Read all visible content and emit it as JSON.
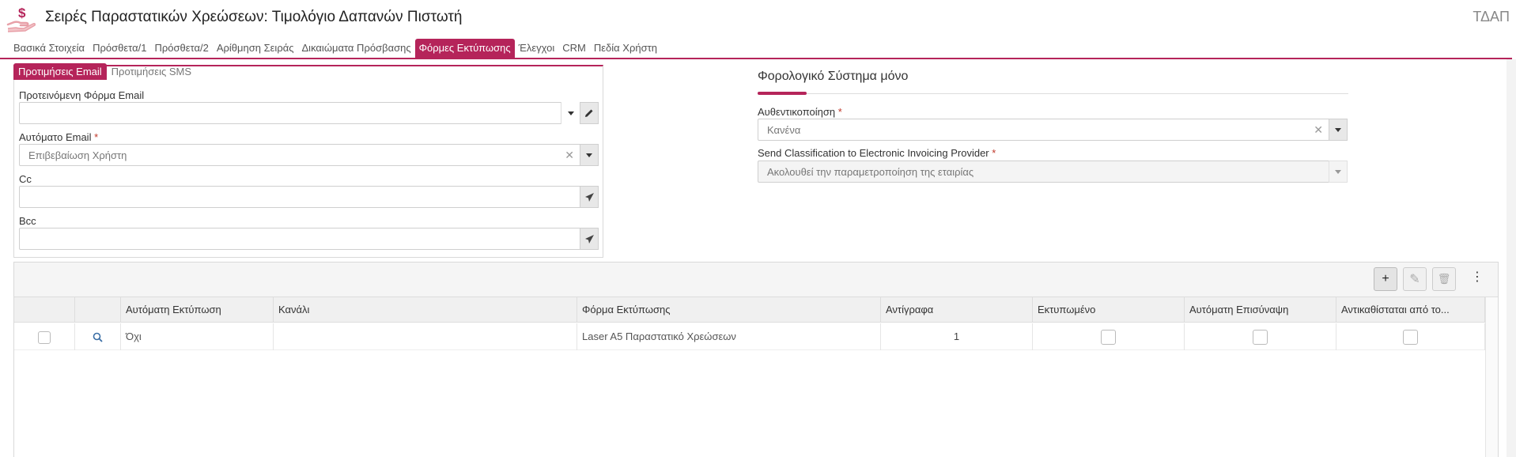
{
  "header": {
    "title": "Σειρές Παραστατικών Χρεώσεων: Τιμολόγιο Δαπανών Πιστωτή",
    "code": "ΤΔΑΠ",
    "icon": "money-hand-icon"
  },
  "tabs": [
    {
      "label": "Βασικά Στοιχεία"
    },
    {
      "label": "Πρόσθετα/1"
    },
    {
      "label": "Πρόσθετα/2"
    },
    {
      "label": "Αρίθμηση Σειράς"
    },
    {
      "label": "Δικαιώματα Πρόσβασης"
    },
    {
      "label": "Φόρμες Εκτύπωσης"
    },
    {
      "label": "Έλεγχοι"
    },
    {
      "label": "CRM"
    },
    {
      "label": "Πεδία Χρήστη"
    }
  ],
  "active_tab": "Φόρμες Εκτύπωσης",
  "email_panel": {
    "subtabs": [
      "Προτιμήσεις Email",
      "Προτιμήσεις SMS"
    ],
    "default_form_label": "Προτεινόμενη Φόρμα Email",
    "default_form_value": "",
    "auto_email_label": "Αυτόματο Email",
    "auto_email_value": "Επιβεβαίωση Χρήστη",
    "cc_label": "Cc",
    "cc_value": "",
    "bcc_label": "Bcc",
    "bcc_value": ""
  },
  "tax_section": {
    "title": "Φορολογικό Σύστημα μόνο",
    "auth_label": "Αυθεντικοποίηση",
    "auth_value": "Κανένα",
    "classification_label": "Send Classification to Electronic Invoicing Provider",
    "classification_value": "Ακολουθεί την παραμετροποίηση της εταιρίας"
  },
  "grid": {
    "toolbar": {
      "add": "+",
      "edit": "✎",
      "delete": "🗑",
      "more": "⋮"
    },
    "columns": [
      "Αυτόματη Εκτύπωση",
      "Κανάλι",
      "Φόρμα Εκτύπωσης",
      "Αντίγραφα",
      "Εκτυπωμένο",
      "Αυτόματη Επισύναψη",
      "Αντικαθίσταται από το..."
    ],
    "rows": [
      {
        "auto_print": "Όχι",
        "channel": "",
        "form": "Laser A5 Παραστατικό Χρεώσεων",
        "copies": "1",
        "printed": false,
        "auto_attach": false,
        "replaced_by": false
      }
    ]
  },
  "colors": {
    "accent": "#b5245a"
  }
}
